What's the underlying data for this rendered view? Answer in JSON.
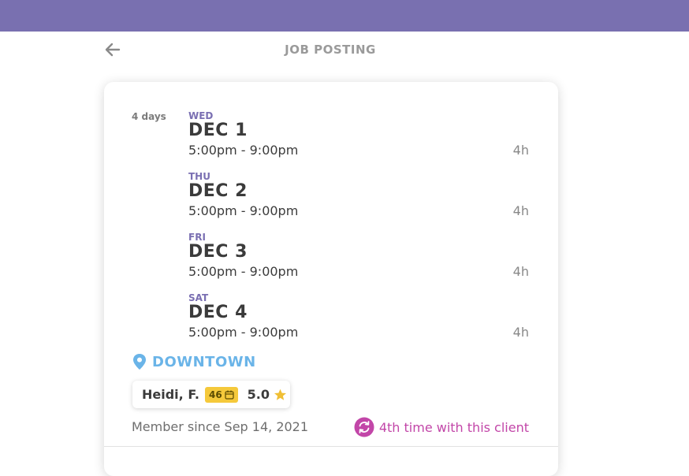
{
  "header": {
    "title": "JOB POSTING"
  },
  "schedule": {
    "total_days": "4 days",
    "days": [
      {
        "weekday": "WED",
        "date": "DEC 1",
        "time": "5:00pm - 9:00pm",
        "duration": "4h"
      },
      {
        "weekday": "THU",
        "date": "DEC 2",
        "time": "5:00pm - 9:00pm",
        "duration": "4h"
      },
      {
        "weekday": "FRI",
        "date": "DEC 3",
        "time": "5:00pm - 9:00pm",
        "duration": "4h"
      },
      {
        "weekday": "SAT",
        "date": "DEC 4",
        "time": "5:00pm - 9:00pm",
        "duration": "4h"
      }
    ]
  },
  "location": {
    "icon": "location-pin-icon",
    "name": "DOWNTOWN"
  },
  "worker": {
    "name": "Heidi, F.",
    "shifts_count": "46",
    "count_icon": "calendar-icon",
    "rating": "5.0",
    "rating_icon": "star-icon",
    "member_since": "Member since Sep 14, 2021"
  },
  "client_history": {
    "icon": "repeat-icon",
    "text": "4th time with this client"
  },
  "colors": {
    "topbar": "#7970b0",
    "weekday": "#7a6fb2",
    "location": "#6ab4e8",
    "badge": "#f5c93b",
    "star": "#f0bf35",
    "repeat": "#c246a8"
  }
}
